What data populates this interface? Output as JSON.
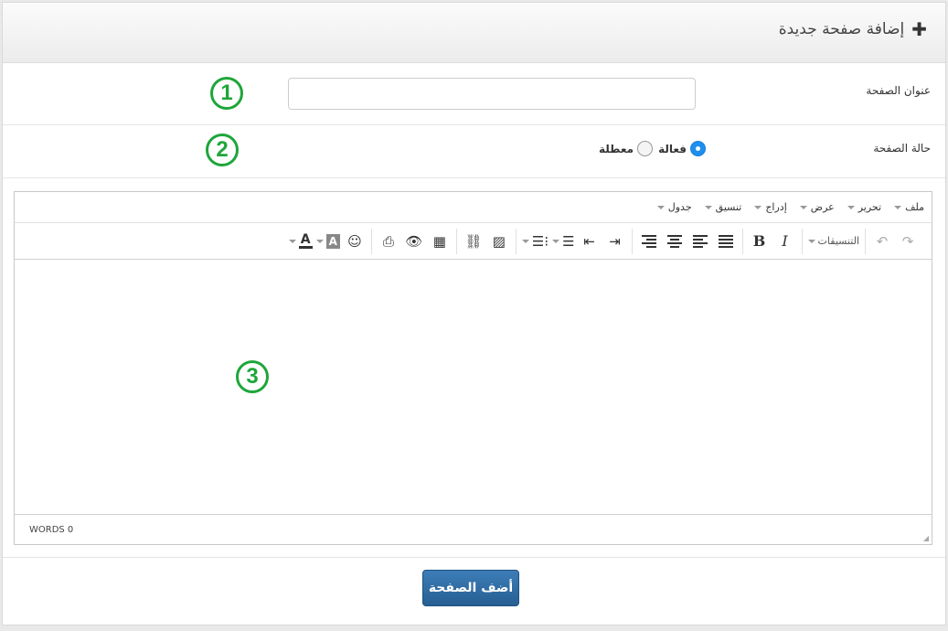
{
  "header": {
    "title": "إضافة صفحة جديدة",
    "icon": "plus-icon"
  },
  "form": {
    "page_title": {
      "label": "عنوان الصفحة",
      "value": "",
      "placeholder": ""
    },
    "page_status": {
      "label": "حالة الصفحة",
      "options": [
        {
          "label": "فعالة",
          "checked": true
        },
        {
          "label": "معطلة",
          "checked": false
        }
      ]
    }
  },
  "editor": {
    "menus": [
      "ملف",
      "تحرير",
      "عرض",
      "إدراج",
      "تنسيق",
      "جدول"
    ],
    "toolbar": {
      "formats_label": "التنسيقات",
      "bold": "B",
      "italic": "I"
    },
    "status": "WORDS 0"
  },
  "markers": [
    "1",
    "2",
    "3"
  ],
  "submit_label": "أضف الصفحة",
  "colors": {
    "accent": "#2a6aa5",
    "marker_green": "#1ea63a",
    "radio_blue": "#1e8ef0"
  }
}
